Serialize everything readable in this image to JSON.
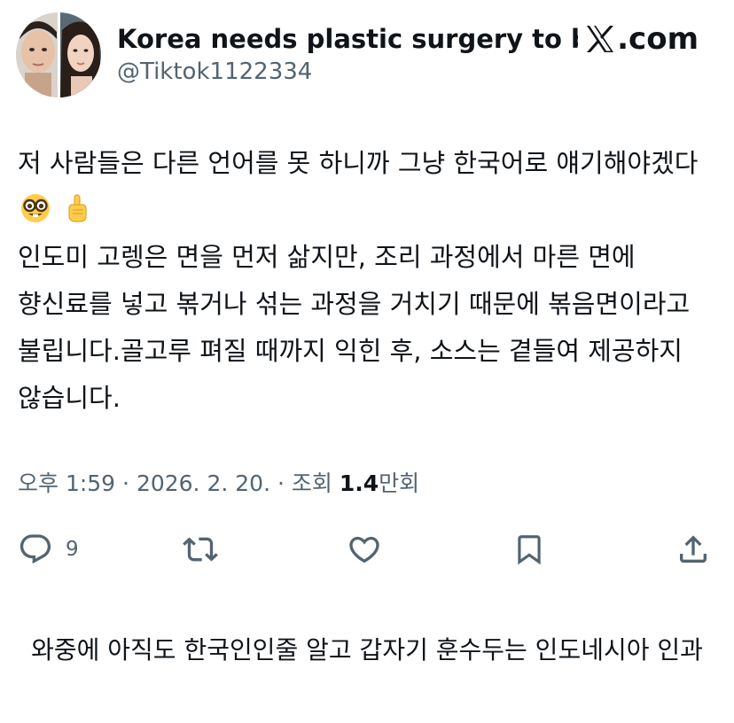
{
  "tweet": {
    "author_name": "Korea needs plastic surgery to b...",
    "handle": "@Tiktok1122334",
    "brand": ".com",
    "brand_icon": "x-logo-icon",
    "text_part1": "저 사람들은 다른 언어를 못 하니까 그냥 한국어로 얘기해야겠다",
    "emoji_1": "nerd-face-emoji",
    "emoji_2": "pointing-up-emoji",
    "text_part2": "인도미 고렝은 면을 먼저 삶지만, 조리 과정에서 마른 면에 향신료를 넣고 볶거나 섞는 과정을 거치기 때문에 볶음면이라고 불립니다.골고루 펴질 때까지 익힌 후, 소스는 곁들여 제공하지 않습니다.",
    "meta": {
      "time": "오후 1:59",
      "sep1": " · ",
      "date": "2026. 2. 20.",
      "sep2": " · ",
      "views_label": "조회 ",
      "views_number": "1.4",
      "views_unit": "만회"
    },
    "actions": {
      "reply_count": "9",
      "icons": [
        "reply-icon",
        "retweet-icon",
        "like-icon",
        "bookmark-icon",
        "share-icon"
      ]
    }
  },
  "caption": "와중에 아직도 한국인인줄 알고 갑자기 훈수두는 인도네시아 인과",
  "colors": {
    "text": "#0f1419",
    "secondary": "#536471",
    "background": "#ffffff"
  }
}
